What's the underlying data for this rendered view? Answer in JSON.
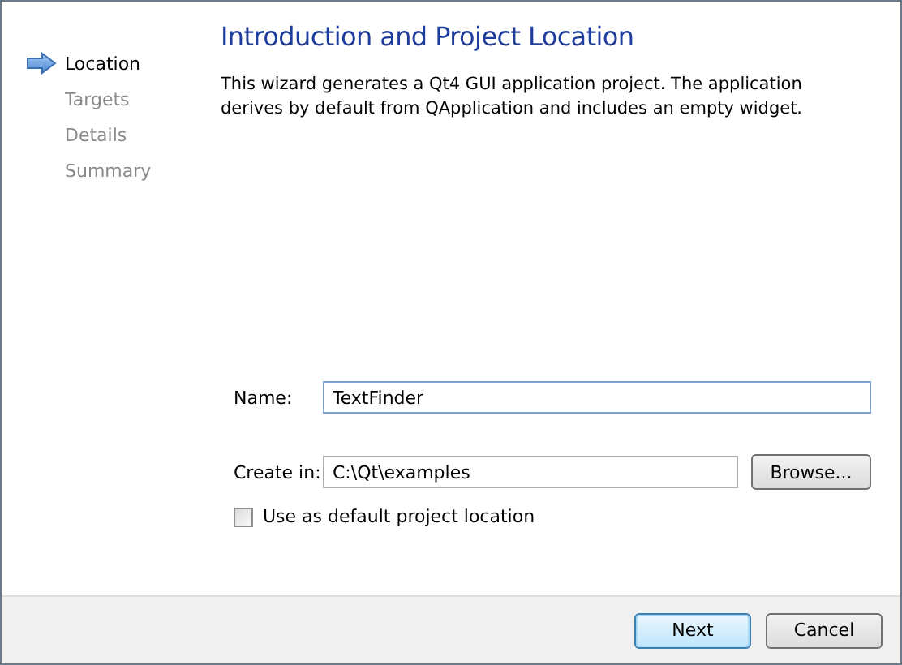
{
  "steps": [
    {
      "label": "Location",
      "selected": true
    },
    {
      "label": "Targets",
      "selected": false
    },
    {
      "label": "Details",
      "selected": false
    },
    {
      "label": "Summary",
      "selected": false
    }
  ],
  "page": {
    "title": "Introduction and Project Location",
    "description": "This wizard generates a Qt4 GUI application project. The application derives by default from QApplication and includes an empty widget."
  },
  "form": {
    "name": {
      "label": "Name:",
      "value": "TextFinder",
      "focused": true
    },
    "location": {
      "label": "Create in:",
      "value": "C:\\Qt\\examples",
      "button": "Browse..."
    },
    "default_location": {
      "label": "Use as default project location",
      "checked": false
    }
  },
  "buttons": [
    {
      "label": "Next",
      "default": true
    },
    {
      "label": "Cancel",
      "default": false
    }
  ]
}
